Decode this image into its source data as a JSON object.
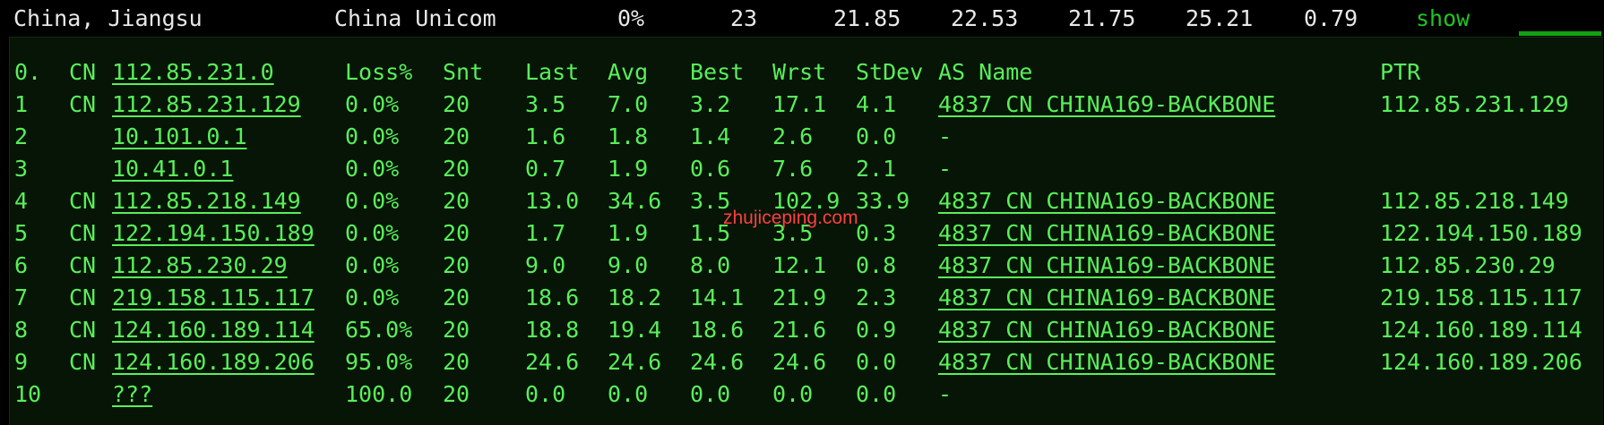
{
  "top": {
    "location": "China, Jiangsu",
    "isp": "China Unicom",
    "loss": "0%",
    "snt": "23",
    "last": "21.85",
    "avg": "22.53",
    "best": "21.75",
    "worst": "25.21",
    "stdev": "0.79",
    "action": "show"
  },
  "watermark": "zhujiceping.com",
  "colors": {
    "terminal_green": "#59ef59",
    "panel_bg": "#061506",
    "top_bg": "#000000",
    "top_text": "#e8e8e8",
    "show_link": "#21c321",
    "watermark": "#ff3f3f"
  },
  "table": {
    "rows": [
      {
        "hop": "0.",
        "cc": "CN",
        "ip": "112.85.231.0",
        "loss": "Loss%",
        "snt": "Snt",
        "last": "Last",
        "avg": "Avg",
        "best": "Best",
        "worst": "Wrst",
        "stdev": "StDev",
        "as_name": "AS Name",
        "ptr": "PTR"
      },
      {
        "hop": "1",
        "cc": "CN",
        "ip": "112.85.231.129",
        "loss": "0.0%",
        "snt": "20",
        "last": "3.5",
        "avg": "7.0",
        "best": "3.2",
        "worst": "17.1",
        "stdev": "4.1",
        "as_name": "4837  CN CHINA169-BACKBONE",
        "ptr": "112.85.231.129"
      },
      {
        "hop": "2",
        "cc": "",
        "ip": "10.101.0.1",
        "loss": "0.0%",
        "snt": "20",
        "last": "1.6",
        "avg": "1.8",
        "best": "1.4",
        "worst": "2.6",
        "stdev": "0.0",
        "as_name": "-",
        "ptr": ""
      },
      {
        "hop": "3",
        "cc": "",
        "ip": "10.41.0.1",
        "loss": "0.0%",
        "snt": "20",
        "last": "0.7",
        "avg": "1.9",
        "best": "0.6",
        "worst": "7.6",
        "stdev": "2.1",
        "as_name": "-",
        "ptr": ""
      },
      {
        "hop": "4",
        "cc": "CN",
        "ip": "112.85.218.149",
        "loss": "0.0%",
        "snt": "20",
        "last": "13.0",
        "avg": "34.6",
        "best": "3.5",
        "worst": "102.9",
        "stdev": "33.9",
        "as_name": "4837  CN CHINA169-BACKBONE",
        "ptr": "112.85.218.149"
      },
      {
        "hop": "5",
        "cc": "CN",
        "ip": "122.194.150.189",
        "loss": "0.0%",
        "snt": "20",
        "last": "1.7",
        "avg": "1.9",
        "best": "1.5",
        "worst": "3.5",
        "stdev": "0.3",
        "as_name": "4837  CN CHINA169-BACKBONE",
        "ptr": "122.194.150.189"
      },
      {
        "hop": "6",
        "cc": "CN",
        "ip": "112.85.230.29",
        "loss": "0.0%",
        "snt": "20",
        "last": "9.0",
        "avg": "9.0",
        "best": "8.0",
        "worst": "12.1",
        "stdev": "0.8",
        "as_name": "4837  CN CHINA169-BACKBONE",
        "ptr": "112.85.230.29"
      },
      {
        "hop": "7",
        "cc": "CN",
        "ip": "219.158.115.117",
        "loss": "0.0%",
        "snt": "20",
        "last": "18.6",
        "avg": "18.2",
        "best": "14.1",
        "worst": "21.9",
        "stdev": "2.3",
        "as_name": "4837  CN CHINA169-BACKBONE",
        "ptr": "219.158.115.117"
      },
      {
        "hop": "8",
        "cc": "CN",
        "ip": "124.160.189.114",
        "loss": "65.0%",
        "snt": "20",
        "last": "18.8",
        "avg": "19.4",
        "best": "18.6",
        "worst": "21.6",
        "stdev": "0.9",
        "as_name": "4837  CN CHINA169-BACKBONE",
        "ptr": "124.160.189.114"
      },
      {
        "hop": "9",
        "cc": "CN",
        "ip": "124.160.189.206",
        "loss": "95.0%",
        "snt": "20",
        "last": "24.6",
        "avg": "24.6",
        "best": "24.6",
        "worst": "24.6",
        "stdev": "0.0",
        "as_name": "4837  CN CHINA169-BACKBONE",
        "ptr": "124.160.189.206"
      },
      {
        "hop": "10",
        "cc": "",
        "ip": "???",
        "loss": "100.0",
        "snt": "20",
        "last": "0.0",
        "avg": "0.0",
        "best": "0.0",
        "worst": "0.0",
        "stdev": "0.0",
        "as_name": "-",
        "ptr": ""
      }
    ]
  }
}
